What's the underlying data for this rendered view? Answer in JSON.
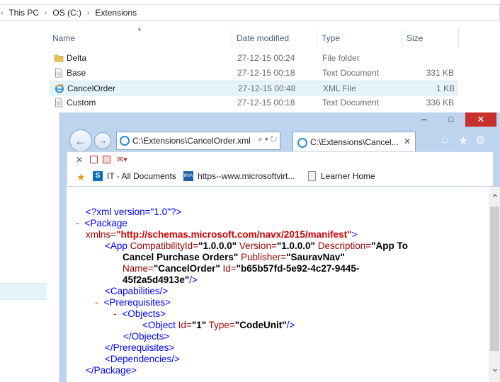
{
  "explorer": {
    "breadcrumb": [
      "This PC",
      "OS (C:)",
      "Extensions"
    ],
    "columns": {
      "name": "Name",
      "date": "Date modified",
      "type": "Type",
      "size": "Size"
    },
    "files": [
      {
        "name": "Delta",
        "date": "27-12-15 00:24",
        "type": "File folder",
        "size": "",
        "icon": "folder-icon"
      },
      {
        "name": "Base",
        "date": "27-12-15 00:18",
        "type": "Text Document",
        "size": "331 KB",
        "icon": "text-document-icon"
      },
      {
        "name": "CancelOrder",
        "date": "27-12-15 00:48",
        "type": "XML File",
        "size": "1 KB",
        "icon": "ie-file-icon"
      },
      {
        "name": "Custom",
        "date": "27-12-15 00:18",
        "type": "Text Document",
        "size": "336 KB",
        "icon": "text-document-icon"
      }
    ]
  },
  "browser": {
    "window_controls": {
      "minimize": "–",
      "maximize": "□",
      "close": "✕"
    },
    "address": "C:\\Extensions\\CancelOrder.xml",
    "address_controls": "⌕ ▾ ↻",
    "tab_title": "C:\\Extensions\\Cancel...",
    "tab_close": "✕",
    "favorites": [
      {
        "label": "IT - All Documents",
        "icon": "sharepoint-icon"
      },
      {
        "label": "https--www.microsoftvirt...",
        "icon": "mva-icon"
      },
      {
        "label": "Learner Home",
        "icon": "page-icon"
      }
    ],
    "command_icons": [
      "close-x-icon",
      "feed-icon",
      "safety-icon",
      "email-icon"
    ],
    "xml": {
      "l1": "<?xml version=\"1.0\"?>",
      "l2_dash": "-",
      "l2": "<Package",
      "l3_attr": "xmlns=",
      "l3_val": "\"http://schemas.microsoft.com/navx/2015/manifest\"",
      "l3_end": ">",
      "l4a": "<App",
      "l4b": " CompatibilityId=",
      "l4c": "\"1.0.0.0\"",
      "l4d": " Version=",
      "l4e": "\"1.0.0.0\"",
      "l4f": " Description=",
      "l4g": "\"App To",
      "l5a": "Cancel Purchase Orders\"",
      "l5b": " Publisher=",
      "l5c": "\"SauravNav\"",
      "l6a": "Name=",
      "l6b": "\"CancelOrder\"",
      "l6c": " Id=",
      "l6d": "\"b65b57fd-5e92-4c27-9445-",
      "l7a": "45f2a5d4913e\"",
      "l7b": "/>",
      "l8": "<Capabilities/>",
      "l9_dash": "-",
      "l9": "<Prerequisites>",
      "l10_dash": "-",
      "l10": "<Objects>",
      "l11a": "<Object",
      "l11b": " Id=",
      "l11c": "\"1\"",
      "l11d": " Type=",
      "l11e": "\"CodeUnit\"",
      "l11f": "/>",
      "l12": "</Objects>",
      "l13": "</Prerequisites>",
      "l14": "<Dependencies/>",
      "l15": "</Package>"
    }
  }
}
